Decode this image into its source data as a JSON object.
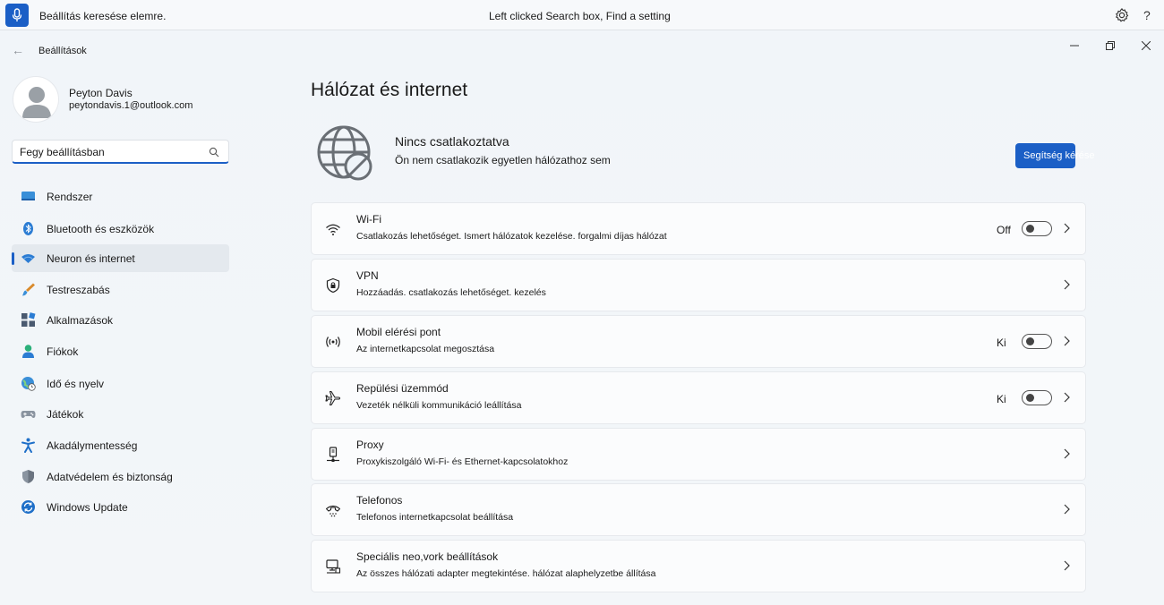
{
  "topbar": {
    "prompt": "Beállítás keresése elemre.",
    "status": "Left clicked Search box, Find a setting"
  },
  "window": {
    "title": "Beállítások"
  },
  "user": {
    "name": "Peyton Davis",
    "email": "peytondavis.1@outlook.com"
  },
  "search": {
    "value": "Fegy beállításban"
  },
  "nav": [
    {
      "label": "Rendszer",
      "icon": "monitor-icon"
    },
    {
      "label": "Bluetooth és eszközök",
      "icon": "bluetooth-icon"
    },
    {
      "label": "Neuron és internet",
      "icon": "wifi-icon",
      "active": true
    },
    {
      "label": "Testreszabás",
      "icon": "brush-icon"
    },
    {
      "label": "Alkalmazások",
      "icon": "apps-icon"
    },
    {
      "label": "Fiókok",
      "icon": "person-icon"
    },
    {
      "label": "Idő és nyelv",
      "icon": "globe-clock-icon"
    },
    {
      "label": "Játékok",
      "icon": "gamepad-icon"
    },
    {
      "label": "Akadálymentesség",
      "icon": "accessibility-icon"
    },
    {
      "label": "Adatvédelem és biztonság",
      "icon": "shield-icon"
    },
    {
      "label": "Windows Update",
      "icon": "update-icon"
    }
  ],
  "main": {
    "title": "Hálózat és internet",
    "status_title": "Nincs csatlakoztatva",
    "status_sub": "Ön nem csatlakozik egyetlen hálózathoz sem",
    "help_button": "Segítség kérése"
  },
  "cards": [
    {
      "title": "Wi-Fi",
      "desc": "Csatlakozás lehetőséget. Ismert hálózatok kezelése. forgalmi díjas hálózat",
      "state": "Off",
      "toggle": false,
      "icon": "wifi-icon"
    },
    {
      "title": "VPN",
      "desc": "Hozzáadás. csatlakozás lehetőséget. kezelés",
      "icon": "vpn-shield-icon"
    },
    {
      "title": "Mobil elérési pont",
      "desc": "Az internetkapcsolat megosztása",
      "state": "Ki",
      "toggle": false,
      "icon": "hotspot-icon"
    },
    {
      "title": "Repülési üzemmód",
      "desc": "Vezeték nélküli kommunikáció leállítása",
      "state": "Ki",
      "toggle": false,
      "icon": "airplane-icon"
    },
    {
      "title": "Proxy",
      "desc": "Proxykiszolgáló Wi-Fi- és Ethernet-kapcsolatokhoz",
      "icon": "proxy-icon"
    },
    {
      "title": "Telefonos",
      "desc": "Telefonos internetkapcsolat beállítása",
      "icon": "dialup-icon"
    },
    {
      "title": "Speciális neo,vork beállítások",
      "desc": "Az összes hálózati adapter megtekintése. hálózat alaphelyzetbe állítása",
      "icon": "network-pc-icon"
    }
  ]
}
